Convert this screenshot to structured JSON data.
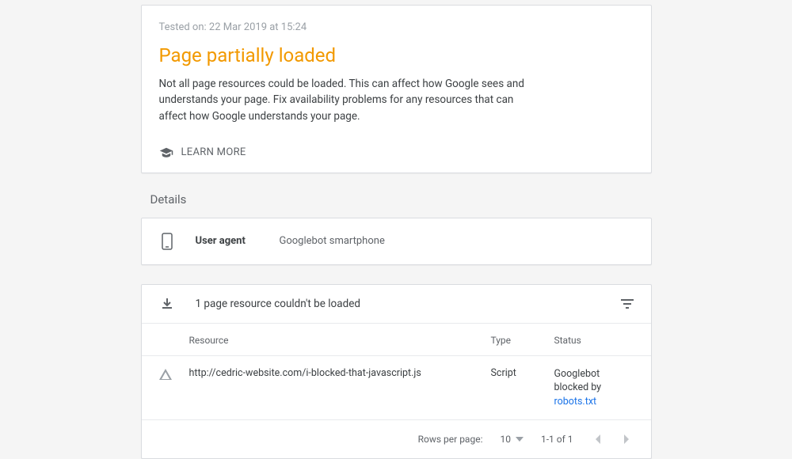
{
  "status": {
    "tested_on": "Tested on: 22 Mar 2019 at 15:24",
    "title": "Page partially loaded",
    "description": "Not all page resources could be loaded. This can affect how Google sees and understands your page. Fix availability problems for any resources that can affect how Google understands your page.",
    "learn_more": "LEARN MORE"
  },
  "details": {
    "section_title": "Details",
    "user_agent_label": "User agent",
    "user_agent_value": "Googlebot smartphone"
  },
  "resources": {
    "header_text": "1 page resource couldn't be loaded",
    "columns": {
      "resource": "Resource",
      "type": "Type",
      "status": "Status"
    },
    "rows": [
      {
        "resource": "http://cedric-website.com/i-blocked-that-javascript.js",
        "type": "Script",
        "status_prefix": "Googlebot blocked by ",
        "status_link": "robots.txt"
      }
    ],
    "pagination": {
      "rows_per_page_label": "Rows per page:",
      "rows_per_page_value": "10",
      "range": "1-1 of 1"
    }
  }
}
